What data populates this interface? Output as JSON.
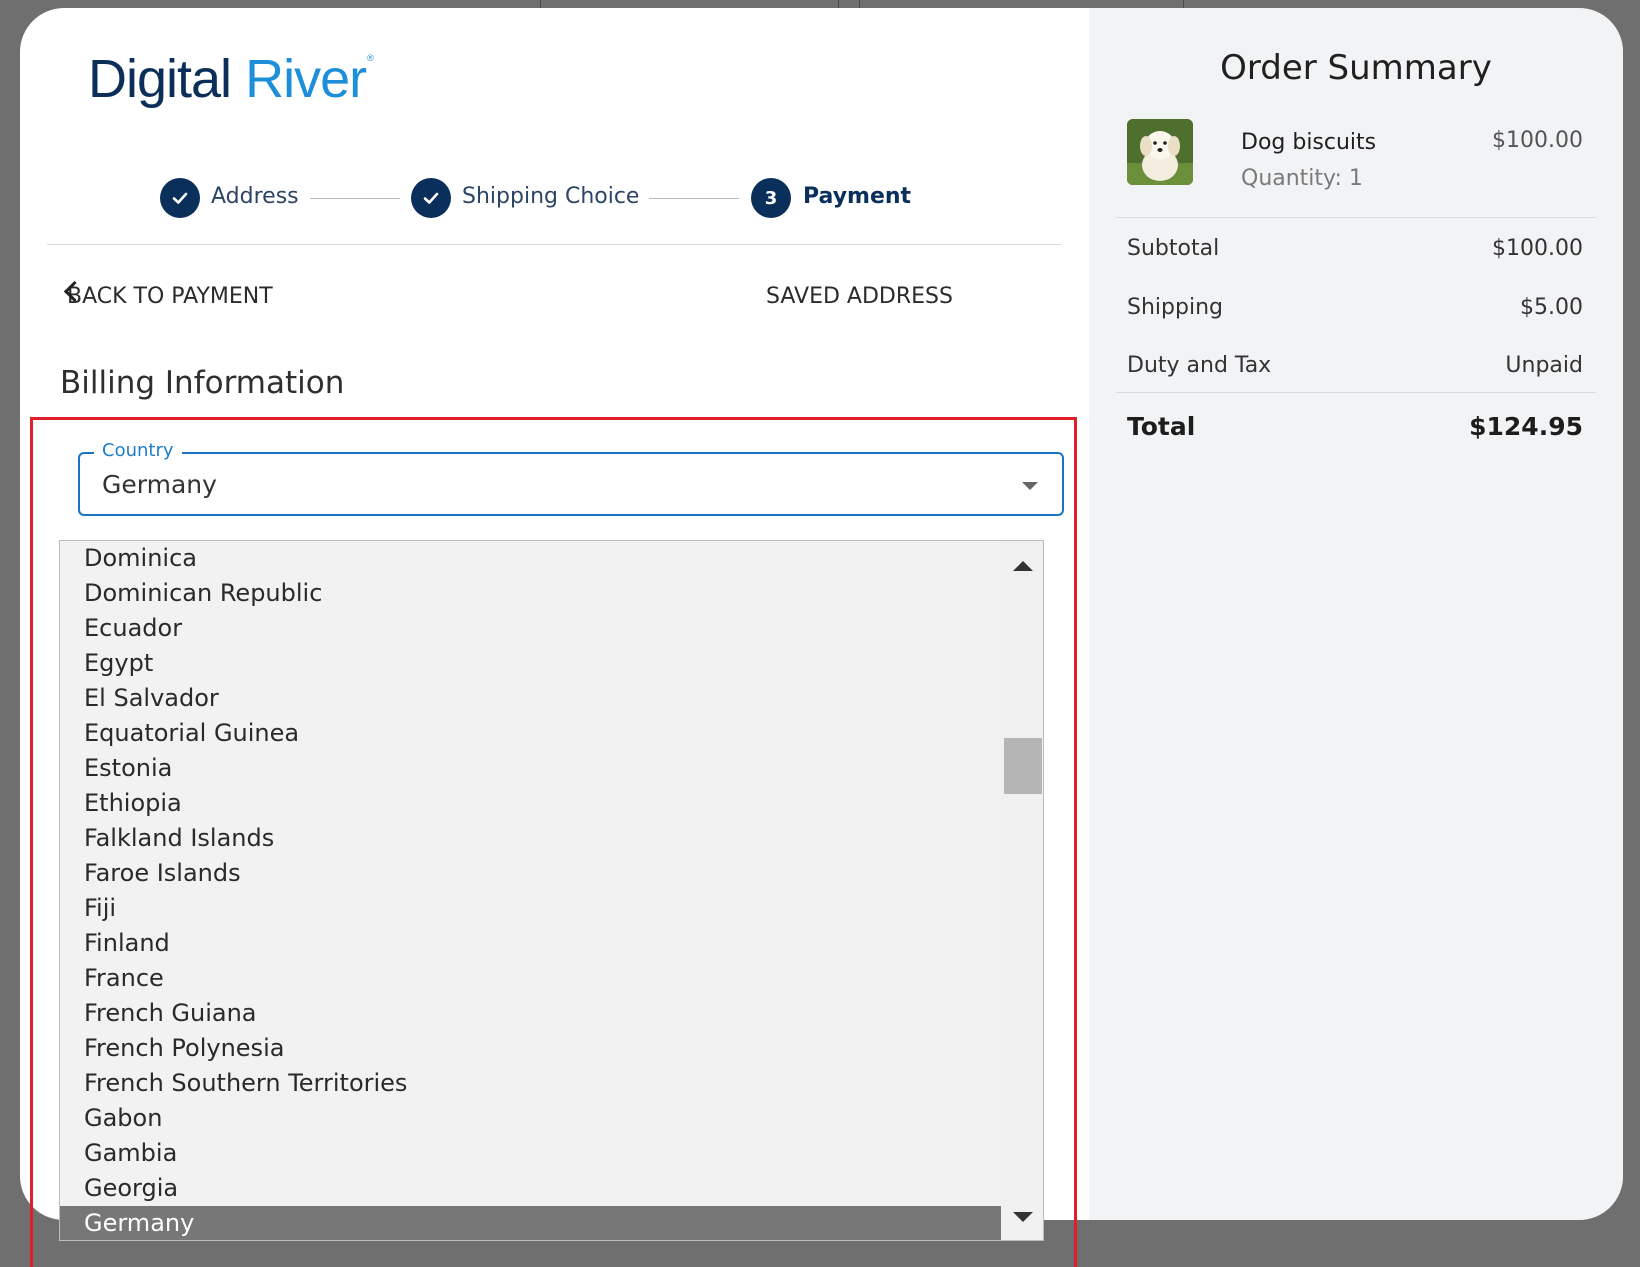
{
  "logo": {
    "word1": "Digital",
    "word2": "River",
    "mark": "®"
  },
  "stepper": {
    "steps": [
      {
        "label": "Address",
        "state": "complete",
        "icon": "check-icon"
      },
      {
        "label": "Shipping Choice",
        "state": "complete",
        "icon": "check-icon"
      },
      {
        "label": "Payment",
        "state": "current",
        "number": "3"
      }
    ]
  },
  "nav": {
    "back_label": "BACK TO PAYMENT",
    "saved_label": "SAVED ADDRESS"
  },
  "billing": {
    "title": "Billing Information",
    "country": {
      "label": "Country",
      "value": "Germany"
    },
    "dropdown_options": [
      "Dominica",
      "Dominican Republic",
      "Ecuador",
      "Egypt",
      "El Salvador",
      "Equatorial Guinea",
      "Estonia",
      "Ethiopia",
      "Falkland Islands",
      "Faroe Islands",
      "Fiji",
      "Finland",
      "France",
      "French Guiana",
      "French Polynesia",
      "French Southern Territories",
      "Gabon",
      "Gambia",
      "Georgia",
      "Germany"
    ],
    "selected_option": "Germany"
  },
  "summary": {
    "title": "Order Summary",
    "item": {
      "name": "Dog biscuits",
      "quantity": "Quantity: 1",
      "price": "$100.00"
    },
    "rows": [
      {
        "label": "Subtotal",
        "value": "$100.00"
      },
      {
        "label": "Shipping",
        "value": "$5.00"
      },
      {
        "label": "Duty and Tax",
        "value": "Unpaid"
      }
    ],
    "total": {
      "label": "Total",
      "value": "$124.95"
    }
  },
  "colors": {
    "brand_navy": "#0b2f5b",
    "brand_blue": "#1d8fd8",
    "focus_blue": "#1b74c3",
    "highlight_red": "#e01f2a",
    "selected_option_bg": "#777777"
  }
}
